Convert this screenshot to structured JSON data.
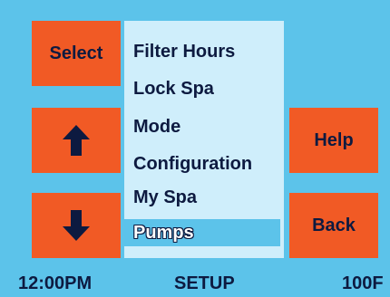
{
  "buttons": {
    "select": "Select",
    "up_icon": "arrow-up-icon",
    "down_icon": "arrow-down-icon",
    "help": "Help",
    "back": "Back"
  },
  "menu": {
    "items": [
      {
        "label": "Filter Hours",
        "selected": false
      },
      {
        "label": "Lock Spa",
        "selected": false
      },
      {
        "label": "Mode",
        "selected": false
      },
      {
        "label": "Configuration",
        "selected": false
      },
      {
        "label": "My Spa",
        "selected": false
      },
      {
        "label": "Pumps",
        "selected": true
      }
    ]
  },
  "status_bar": {
    "time": "12:00PM",
    "mode": "SETUP",
    "temperature": "100F"
  },
  "colors": {
    "screen_background": "#5cc3ea",
    "button": "#f15a25",
    "menu_background": "#cfeefb",
    "selected_background": "#5cc3ea",
    "text": "#0d1a40"
  }
}
